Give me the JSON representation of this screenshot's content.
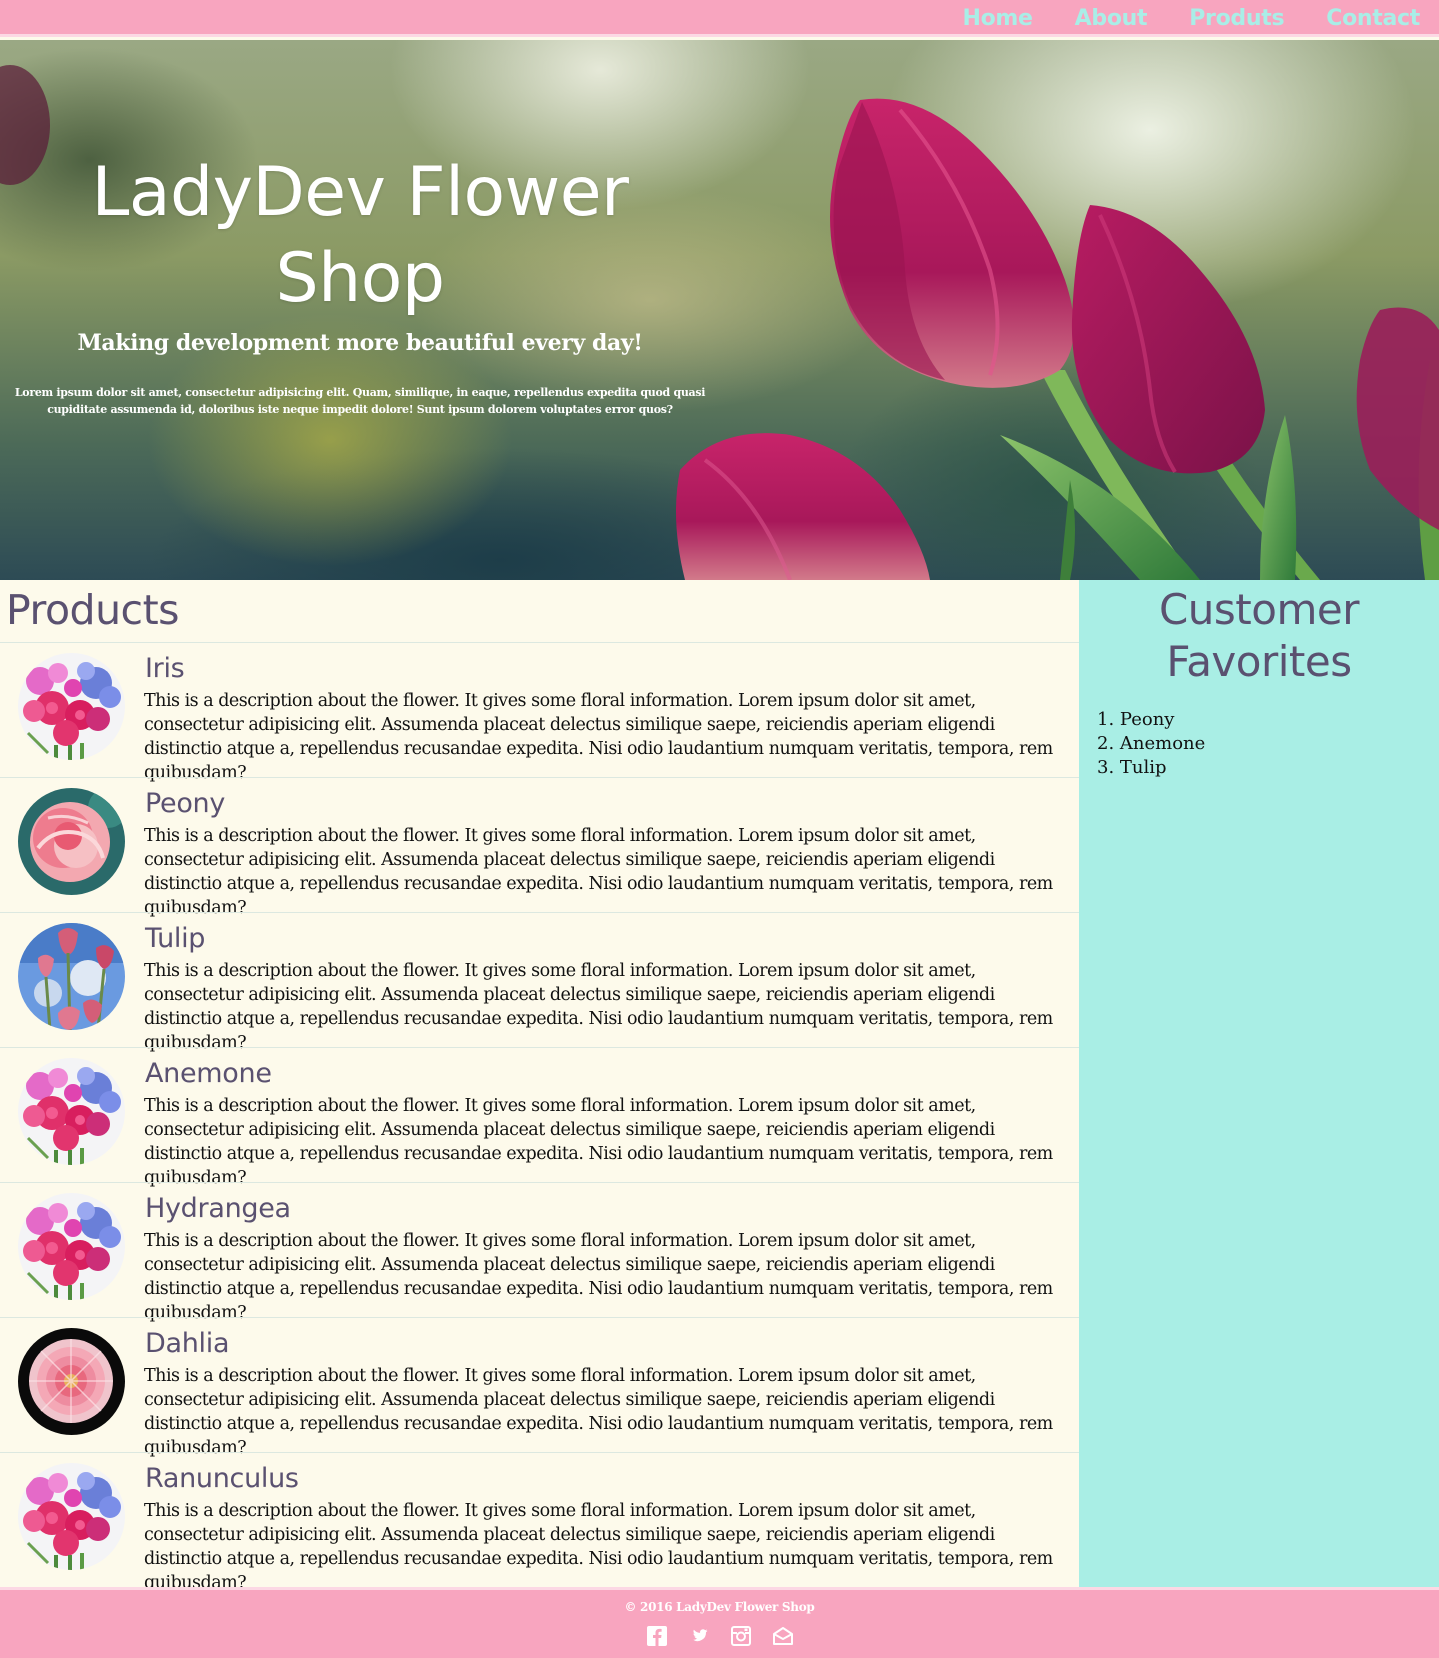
{
  "nav": {
    "items": [
      {
        "label": "Home"
      },
      {
        "label": "About"
      },
      {
        "label": "Produts"
      },
      {
        "label": "Contact"
      }
    ]
  },
  "hero": {
    "title": "LadyDev Flower Shop",
    "subtitle": "Making development more beautiful every day!",
    "blurb": "Lorem ipsum dolor sit amet, consectetur adipisicing elit. Quam, similique, in eaque, repellendus expedita quod quasi cupiditate assumenda id, doloribus iste neque impedit dolore! Sunt ipsum dolorem voluptates error quos?"
  },
  "products": {
    "heading": "Products",
    "items": [
      {
        "name": "Iris",
        "description": "This is a description about the flower. It gives some floral information. Lorem ipsum dolor sit amet, consectetur adipisicing elit. Assumenda placeat delectus similique saepe, reiciendis aperiam eligendi distinctio atque a, repellendus recusandae expedita. Nisi odio laudantium numquam veritatis, tempora, rem quibusdam?",
        "image": "bouquet"
      },
      {
        "name": "Peony",
        "description": "This is a description about the flower. It gives some floral information. Lorem ipsum dolor sit amet, consectetur adipisicing elit. Assumenda placeat delectus similique saepe, reiciendis aperiam eligendi distinctio atque a, repellendus recusandae expedita. Nisi odio laudantium numquam veritatis, tempora, rem quibusdam?",
        "image": "peony"
      },
      {
        "name": "Tulip",
        "description": "This is a description about the flower. It gives some floral information. Lorem ipsum dolor sit amet, consectetur adipisicing elit. Assumenda placeat delectus similique saepe, reiciendis aperiam eligendi distinctio atque a, repellendus recusandae expedita. Nisi odio laudantium numquam veritatis, tempora, rem quibusdam?",
        "image": "tulip"
      },
      {
        "name": "Anemone",
        "description": "This is a description about the flower. It gives some floral information. Lorem ipsum dolor sit amet, consectetur adipisicing elit. Assumenda placeat delectus similique saepe, reiciendis aperiam eligendi distinctio atque a, repellendus recusandae expedita. Nisi odio laudantium numquam veritatis, tempora, rem quibusdam?",
        "image": "bouquet"
      },
      {
        "name": "Hydrangea",
        "description": "This is a description about the flower. It gives some floral information. Lorem ipsum dolor sit amet, consectetur adipisicing elit. Assumenda placeat delectus similique saepe, reiciendis aperiam eligendi distinctio atque a, repellendus recusandae expedita. Nisi odio laudantium numquam veritatis, tempora, rem quibusdam?",
        "image": "bouquet"
      },
      {
        "name": "Dahlia",
        "description": "This is a description about the flower. It gives some floral information. Lorem ipsum dolor sit amet, consectetur adipisicing elit. Assumenda placeat delectus similique saepe, reiciendis aperiam eligendi distinctio atque a, repellendus recusandae expedita. Nisi odio laudantium numquam veritatis, tempora, rem quibusdam?",
        "image": "dahlia"
      },
      {
        "name": "Ranunculus",
        "description": "This is a description about the flower. It gives some floral information. Lorem ipsum dolor sit amet, consectetur adipisicing elit. Assumenda placeat delectus similique saepe, reiciendis aperiam eligendi distinctio atque a, repellendus recusandae expedita. Nisi odio laudantium numquam veritatis, tempora, rem quibusdam?",
        "image": "bouquet"
      }
    ]
  },
  "sidebar": {
    "heading": "Customer Favorites",
    "favorites": [
      "1. Peony",
      "2. Anemone",
      "3. Tulip"
    ]
  },
  "footer": {
    "copyright": "© 2016 LadyDev Flower Shop",
    "social": [
      {
        "icon": "facebook-icon"
      },
      {
        "icon": "twitter-icon"
      },
      {
        "icon": "instagram-icon"
      },
      {
        "icon": "mail-icon"
      }
    ]
  },
  "colors": {
    "nav_bg": "#f8a5bf",
    "nav_link": "#a9eee7",
    "heading": "#5a5170",
    "sidebar_bg": "#a9eee5",
    "main_bg": "#fdfaeb"
  }
}
